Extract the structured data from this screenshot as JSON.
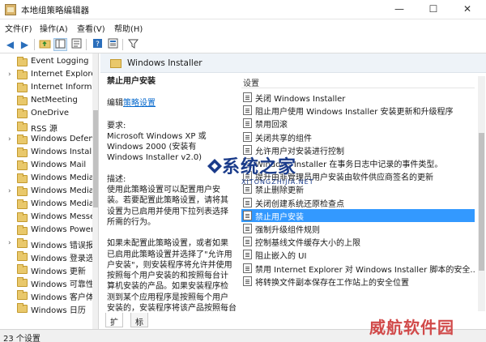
{
  "window": {
    "title": "本地组策略编辑器",
    "minimize_glyph": "—",
    "maximize_glyph": "☐",
    "close_glyph": "✕"
  },
  "menu": [
    "文件(F)",
    "操作(A)",
    "查看(V)",
    "帮助(H)"
  ],
  "toolbar": {
    "icons": [
      "back-icon",
      "forward-icon",
      "folder-up-icon",
      "show-hide-tree-icon",
      "export-list-icon",
      "help-icon",
      "properties-icon",
      "filter-icon"
    ],
    "back_glyph": "◀",
    "forward_glyph": "▶",
    "filter_glyph": "⚲"
  },
  "tree": {
    "items": [
      {
        "label": "Event Logging",
        "has_children": false
      },
      {
        "label": "Internet Explorer",
        "has_children": true
      },
      {
        "label": "Internet Informat",
        "has_children": false
      },
      {
        "label": "NetMeeting",
        "has_children": false
      },
      {
        "label": "OneDrive",
        "has_children": false
      },
      {
        "label": "RSS 源",
        "has_children": false
      },
      {
        "label": "Windows Defender",
        "has_children": true
      },
      {
        "label": "Windows Installer",
        "has_children": false
      },
      {
        "label": "Windows Mail",
        "has_children": false
      },
      {
        "label": "Windows Media",
        "has_children": false
      },
      {
        "label": "Windows Media",
        "has_children": true
      },
      {
        "label": "Windows Media",
        "has_children": false
      },
      {
        "label": "Windows Messen",
        "has_children": false
      },
      {
        "label": "Windows Powers",
        "has_children": false
      },
      {
        "label": "Windows 错误报",
        "has_children": true
      },
      {
        "label": "Windows 登录选",
        "has_children": false
      },
      {
        "label": "Windows 更新",
        "has_children": false
      },
      {
        "label": "Windows 可靠性",
        "has_children": false
      },
      {
        "label": "Windows 客户体",
        "has_children": false
      },
      {
        "label": "Windows 日历",
        "has_children": false
      }
    ],
    "arrow_glyph": "›"
  },
  "main": {
    "header": "Windows Installer",
    "description": {
      "title": "禁止用户安装",
      "edit_prefix": "编辑",
      "edit_link": "策略设置",
      "requirements_label": "要求:",
      "requirements_lines": [
        "Microsoft Windows XP 或",
        "Windows 2000 (安装有",
        "Windows Installer v2.0)"
      ],
      "desc_label": "描述:",
      "desc_lines": [
        "使用此策略设置可以配置用户安",
        "装。若要配置此策略设置，请将其",
        "设置为已启用并使用下拉列表选择",
        "所需的行为。"
      ],
      "desc2_lines": [
        "如果未配置此策略设置，或者如果",
        "已启用此策略设置并选择了\"允许用",
        "户安装\"，则安装程序将允许并使用",
        "按照每个用户安装的和按照每台计",
        "算机安装的产品。如果安装程序检",
        "测到某个应用程序是按照每个用户",
        "安装的，安装程序将该产品按照每台计"
      ]
    },
    "list": {
      "column_header": "设置",
      "selected_index": 9,
      "items": [
        "关闭 Windows Installer",
        "阻止用户使用 Windows Installer 安装更新和升级程序",
        "禁用回滚",
        "关闭共享的组件",
        "允许用户对安装进行控制",
        "Windows Installer 在事务日志中记录的事件类型。",
        "提升由非管理员用户安装由软件供应商签名的更新",
        "禁止删除更新",
        "关闭创建系统还原检查点",
        "禁止用户安装",
        "强制升级组件规则",
        "控制基线文件缓存大小的上限",
        "阻止嵌入的 UI",
        "禁用 Internet Explorer 对 Windows Installer 脚本的安全...",
        "将转换文件副本保存在工作站上的安全位置"
      ]
    }
  },
  "tabs": [
    "扩展",
    "标准"
  ],
  "status": "23 个设置",
  "watermark": {
    "brand": "系统之家",
    "domain": "XITONGZHIJIA.NET",
    "corner": "威航软件园"
  }
}
